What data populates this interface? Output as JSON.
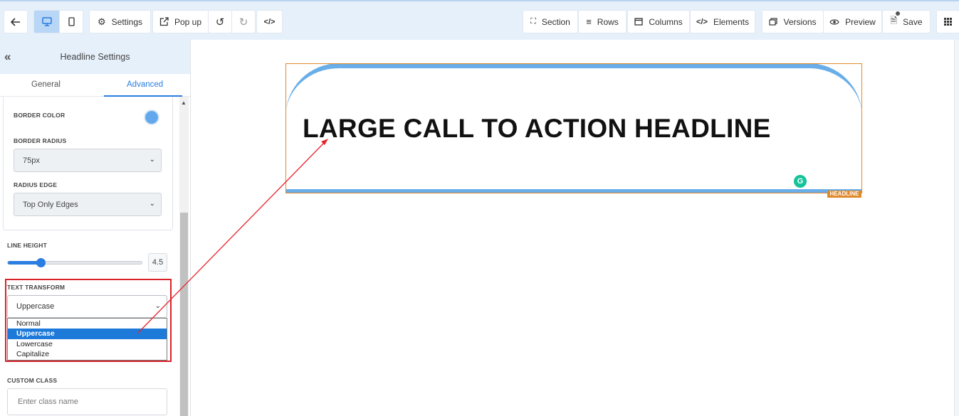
{
  "toolbar": {
    "settings_label": "Settings",
    "popup_label": "Pop up",
    "section_label": "Section",
    "rows_label": "Rows",
    "columns_label": "Columns",
    "elements_label": "Elements",
    "versions_label": "Versions",
    "preview_label": "Preview",
    "save_label": "Save"
  },
  "panel": {
    "title": "Headline Settings",
    "tabs": [
      "General",
      "Advanced"
    ],
    "active_tab": "Advanced",
    "border_color_label": "BORDER COLOR",
    "border_color_value": "#61a9ec",
    "border_radius_label": "BORDER RADIUS",
    "border_radius_value": "75px",
    "radius_edge_label": "RADIUS EDGE",
    "radius_edge_value": "Top Only Edges",
    "line_height_label": "LINE HEIGHT",
    "line_height_value": "4.5",
    "line_height_fraction": 0.24,
    "text_transform_label": "TEXT TRANSFORM",
    "text_transform_value": "Uppercase",
    "text_transform_options": [
      "Normal",
      "Uppercase",
      "Lowercase",
      "Capitalize"
    ],
    "custom_class_label": "CUSTOM CLASS",
    "custom_class_placeholder": "Enter class name"
  },
  "canvas": {
    "headline_text": "LARGE CALL TO ACTION HEADLINE",
    "element_badge": "HEADLINE",
    "grammarly_letter": "G"
  },
  "colors": {
    "accent": "#2a7de1",
    "headline_border": "#69aee9",
    "selection_outline": "#e08a2b",
    "annotation_red": "#d9232a"
  }
}
